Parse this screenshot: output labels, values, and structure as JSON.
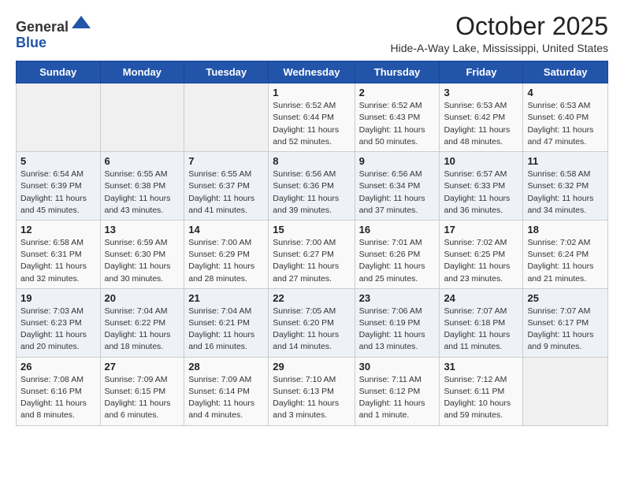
{
  "header": {
    "logo_general": "General",
    "logo_blue": "Blue",
    "month_title": "October 2025",
    "location": "Hide-A-Way Lake, Mississippi, United States"
  },
  "weekdays": [
    "Sunday",
    "Monday",
    "Tuesday",
    "Wednesday",
    "Thursday",
    "Friday",
    "Saturday"
  ],
  "weeks": [
    [
      {
        "day": "",
        "info": ""
      },
      {
        "day": "",
        "info": ""
      },
      {
        "day": "",
        "info": ""
      },
      {
        "day": "1",
        "info": "Sunrise: 6:52 AM\nSunset: 6:44 PM\nDaylight: 11 hours\nand 52 minutes."
      },
      {
        "day": "2",
        "info": "Sunrise: 6:52 AM\nSunset: 6:43 PM\nDaylight: 11 hours\nand 50 minutes."
      },
      {
        "day": "3",
        "info": "Sunrise: 6:53 AM\nSunset: 6:42 PM\nDaylight: 11 hours\nand 48 minutes."
      },
      {
        "day": "4",
        "info": "Sunrise: 6:53 AM\nSunset: 6:40 PM\nDaylight: 11 hours\nand 47 minutes."
      }
    ],
    [
      {
        "day": "5",
        "info": "Sunrise: 6:54 AM\nSunset: 6:39 PM\nDaylight: 11 hours\nand 45 minutes."
      },
      {
        "day": "6",
        "info": "Sunrise: 6:55 AM\nSunset: 6:38 PM\nDaylight: 11 hours\nand 43 minutes."
      },
      {
        "day": "7",
        "info": "Sunrise: 6:55 AM\nSunset: 6:37 PM\nDaylight: 11 hours\nand 41 minutes."
      },
      {
        "day": "8",
        "info": "Sunrise: 6:56 AM\nSunset: 6:36 PM\nDaylight: 11 hours\nand 39 minutes."
      },
      {
        "day": "9",
        "info": "Sunrise: 6:56 AM\nSunset: 6:34 PM\nDaylight: 11 hours\nand 37 minutes."
      },
      {
        "day": "10",
        "info": "Sunrise: 6:57 AM\nSunset: 6:33 PM\nDaylight: 11 hours\nand 36 minutes."
      },
      {
        "day": "11",
        "info": "Sunrise: 6:58 AM\nSunset: 6:32 PM\nDaylight: 11 hours\nand 34 minutes."
      }
    ],
    [
      {
        "day": "12",
        "info": "Sunrise: 6:58 AM\nSunset: 6:31 PM\nDaylight: 11 hours\nand 32 minutes."
      },
      {
        "day": "13",
        "info": "Sunrise: 6:59 AM\nSunset: 6:30 PM\nDaylight: 11 hours\nand 30 minutes."
      },
      {
        "day": "14",
        "info": "Sunrise: 7:00 AM\nSunset: 6:29 PM\nDaylight: 11 hours\nand 28 minutes."
      },
      {
        "day": "15",
        "info": "Sunrise: 7:00 AM\nSunset: 6:27 PM\nDaylight: 11 hours\nand 27 minutes."
      },
      {
        "day": "16",
        "info": "Sunrise: 7:01 AM\nSunset: 6:26 PM\nDaylight: 11 hours\nand 25 minutes."
      },
      {
        "day": "17",
        "info": "Sunrise: 7:02 AM\nSunset: 6:25 PM\nDaylight: 11 hours\nand 23 minutes."
      },
      {
        "day": "18",
        "info": "Sunrise: 7:02 AM\nSunset: 6:24 PM\nDaylight: 11 hours\nand 21 minutes."
      }
    ],
    [
      {
        "day": "19",
        "info": "Sunrise: 7:03 AM\nSunset: 6:23 PM\nDaylight: 11 hours\nand 20 minutes."
      },
      {
        "day": "20",
        "info": "Sunrise: 7:04 AM\nSunset: 6:22 PM\nDaylight: 11 hours\nand 18 minutes."
      },
      {
        "day": "21",
        "info": "Sunrise: 7:04 AM\nSunset: 6:21 PM\nDaylight: 11 hours\nand 16 minutes."
      },
      {
        "day": "22",
        "info": "Sunrise: 7:05 AM\nSunset: 6:20 PM\nDaylight: 11 hours\nand 14 minutes."
      },
      {
        "day": "23",
        "info": "Sunrise: 7:06 AM\nSunset: 6:19 PM\nDaylight: 11 hours\nand 13 minutes."
      },
      {
        "day": "24",
        "info": "Sunrise: 7:07 AM\nSunset: 6:18 PM\nDaylight: 11 hours\nand 11 minutes."
      },
      {
        "day": "25",
        "info": "Sunrise: 7:07 AM\nSunset: 6:17 PM\nDaylight: 11 hours\nand 9 minutes."
      }
    ],
    [
      {
        "day": "26",
        "info": "Sunrise: 7:08 AM\nSunset: 6:16 PM\nDaylight: 11 hours\nand 8 minutes."
      },
      {
        "day": "27",
        "info": "Sunrise: 7:09 AM\nSunset: 6:15 PM\nDaylight: 11 hours\nand 6 minutes."
      },
      {
        "day": "28",
        "info": "Sunrise: 7:09 AM\nSunset: 6:14 PM\nDaylight: 11 hours\nand 4 minutes."
      },
      {
        "day": "29",
        "info": "Sunrise: 7:10 AM\nSunset: 6:13 PM\nDaylight: 11 hours\nand 3 minutes."
      },
      {
        "day": "30",
        "info": "Sunrise: 7:11 AM\nSunset: 6:12 PM\nDaylight: 11 hours\nand 1 minute."
      },
      {
        "day": "31",
        "info": "Sunrise: 7:12 AM\nSunset: 6:11 PM\nDaylight: 10 hours\nand 59 minutes."
      },
      {
        "day": "",
        "info": ""
      }
    ]
  ]
}
